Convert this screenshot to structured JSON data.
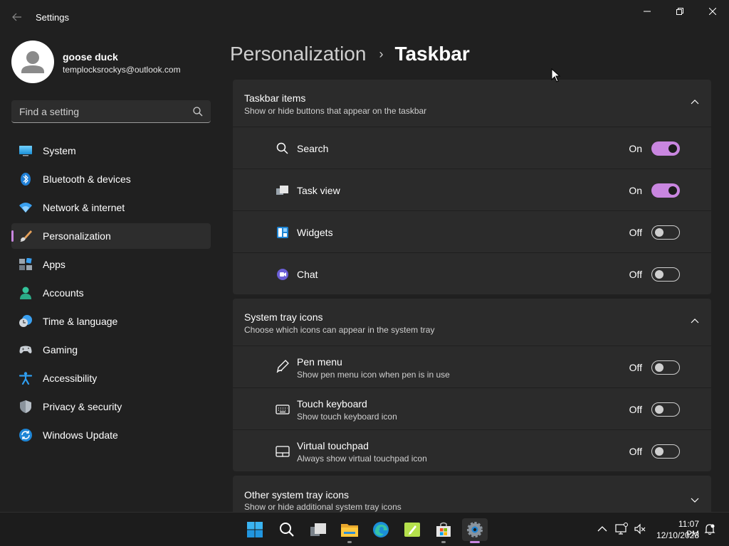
{
  "window": {
    "title": "Settings",
    "back_icon": "back-arrow-icon",
    "controls": [
      "minimize-icon",
      "maximize-icon",
      "close-icon"
    ]
  },
  "user": {
    "name": "goose duck",
    "email": "templocksrockys@outlook.com"
  },
  "search": {
    "placeholder": "Find a setting",
    "value": ""
  },
  "sidebar": {
    "items": [
      {
        "label": "System",
        "icon": "system-icon",
        "active": false
      },
      {
        "label": "Bluetooth & devices",
        "icon": "bluetooth-icon",
        "active": false
      },
      {
        "label": "Network & internet",
        "icon": "wifi-icon",
        "active": false
      },
      {
        "label": "Personalization",
        "icon": "brush-icon",
        "active": true
      },
      {
        "label": "Apps",
        "icon": "apps-icon",
        "active": false
      },
      {
        "label": "Accounts",
        "icon": "accounts-icon",
        "active": false
      },
      {
        "label": "Time & language",
        "icon": "clock-globe-icon",
        "active": false
      },
      {
        "label": "Gaming",
        "icon": "gamepad-icon",
        "active": false
      },
      {
        "label": "Accessibility",
        "icon": "accessibility-icon",
        "active": false
      },
      {
        "label": "Privacy & security",
        "icon": "shield-icon",
        "active": false
      },
      {
        "label": "Windows Update",
        "icon": "update-icon",
        "active": false
      }
    ]
  },
  "breadcrumb": {
    "parent": "Personalization",
    "separator": "›",
    "current": "Taskbar"
  },
  "sections": {
    "taskbar_items": {
      "title": "Taskbar items",
      "subtitle": "Show or hide buttons that appear on the taskbar",
      "expanded": true,
      "rows": [
        {
          "label": "Search",
          "icon": "search-icon",
          "state": "On",
          "on": true
        },
        {
          "label": "Task view",
          "icon": "task-view-icon",
          "state": "On",
          "on": true
        },
        {
          "label": "Widgets",
          "icon": "widgets-icon",
          "state": "Off",
          "on": false
        },
        {
          "label": "Chat",
          "icon": "chat-icon",
          "state": "Off",
          "on": false
        }
      ]
    },
    "system_tray": {
      "title": "System tray icons",
      "subtitle": "Choose which icons can appear in the system tray",
      "expanded": true,
      "rows": [
        {
          "label": "Pen menu",
          "sub": "Show pen menu icon when pen is in use",
          "icon": "pen-icon",
          "state": "Off",
          "on": false
        },
        {
          "label": "Touch keyboard",
          "sub": "Show touch keyboard icon",
          "icon": "keyboard-icon",
          "state": "Off",
          "on": false
        },
        {
          "label": "Virtual touchpad",
          "sub": "Always show virtual touchpad icon",
          "icon": "touchpad-icon",
          "state": "Off",
          "on": false
        }
      ]
    },
    "other_tray": {
      "title": "Other system tray icons",
      "subtitle": "Show or hide additional system tray icons",
      "expanded": false
    }
  },
  "taskbar": {
    "apps": [
      "start-icon",
      "search-icon",
      "task-view-icon",
      "file-explorer-icon",
      "edge-icon",
      "notepad-icon",
      "store-icon",
      "settings-icon"
    ],
    "tray": [
      "chevron-up-icon",
      "network-icon",
      "volume-muted-icon"
    ],
    "time": "11:07 PM",
    "date": "12/10/2023",
    "notification_icon": "notification-bell-icon"
  },
  "colors": {
    "accent": "#c986e0",
    "background": "#202020",
    "card": "#2b2b2b"
  }
}
